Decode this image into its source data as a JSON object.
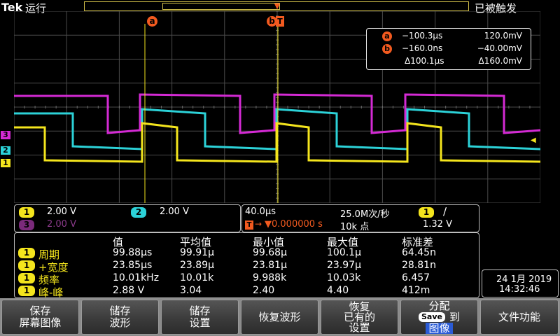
{
  "top": {
    "brand": "Tek",
    "run_state": "运行",
    "trigger_state": "已被触发"
  },
  "cursor_labels": {
    "a": "a",
    "b": "b"
  },
  "cursor_readout": {
    "a": {
      "label": "a",
      "time": "−100.3µs",
      "value": "120.0mV"
    },
    "b": {
      "label": "b",
      "time": "−160.0ns",
      "value": "−40.00mV"
    },
    "delta": {
      "time": "Δ100.1µs",
      "value": "Δ160.0mV"
    }
  },
  "channel_markers": {
    "ch3": "3",
    "ch2": "2",
    "ch1": "1"
  },
  "vertical": {
    "ch1": {
      "num": "1",
      "scale": "2.00 V"
    },
    "ch2": {
      "num": "2",
      "scale": "2.00 V"
    },
    "ch3": {
      "num": "3",
      "scale": "2.00 V"
    }
  },
  "horizontal": {
    "scale": "40.0µs",
    "sample_rate": "25.0M次/秒",
    "trigger_pos_label": "T",
    "trigger_pos": "▼0.000000 s",
    "record_length": "10k 点"
  },
  "trigger": {
    "channel": "1",
    "slope": "∕",
    "level": "1.32 V"
  },
  "measurements": {
    "headers": [
      "值",
      "平均值",
      "最小值",
      "最大值",
      "标准差"
    ],
    "rows": [
      {
        "ch": "1",
        "name": "周期",
        "value": "99.88µs",
        "mean": "99.91µ",
        "min": "99.68µ",
        "max": "100.1µ",
        "std": "64.45n"
      },
      {
        "ch": "1",
        "name": "+宽度",
        "value": "23.85µs",
        "mean": "23.89µ",
        "min": "23.81µ",
        "max": "23.97µ",
        "std": "28.81n"
      },
      {
        "ch": "1",
        "name": "频率",
        "value": "10.01kHz",
        "mean": "10.01k",
        "min": "9.988k",
        "max": "10.03k",
        "std": "6.457"
      },
      {
        "ch": "1",
        "name": "峰-峰",
        "value": "2.88 V",
        "mean": "3.04",
        "min": "2.40",
        "max": "4.40",
        "std": "412m"
      }
    ]
  },
  "datetime": {
    "date": "24 1月 2019",
    "time": "14:32:46"
  },
  "menu": {
    "save_screen": [
      "保存",
      "屏幕图像"
    ],
    "save_waveform": [
      "储存",
      "波形"
    ],
    "save_setup": [
      "储存",
      "设置"
    ],
    "recall_waveform": "恢复波形",
    "recall_setup": [
      "恢复",
      "已有的",
      "设置"
    ],
    "assign": {
      "line1": "分配",
      "save_key": "Save",
      "to": "到",
      "target": "图像"
    },
    "file_functions": "文件功能"
  },
  "colors": {
    "ch1": "#f4e51d",
    "ch2": "#2cd2d8",
    "ch3": "#d42ad4",
    "cursor": "#f25a1f",
    "grid": "#5a5a5a"
  }
}
